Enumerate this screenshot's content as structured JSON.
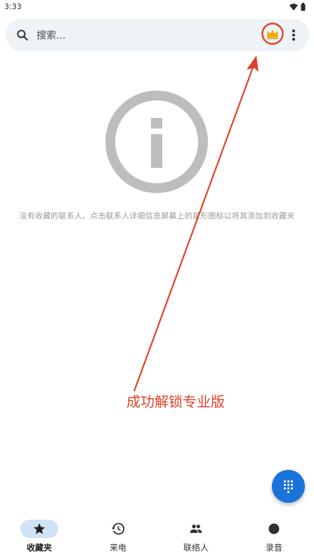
{
  "status_bar": {
    "time": "3:33"
  },
  "search": {
    "placeholder": "搜索..."
  },
  "empty_state": {
    "message": "没有收藏的联系人。点击联系人详细信息屏幕上的星形图标以将其添加到收藏夹"
  },
  "annotation": {
    "text": "成功解锁专业版",
    "color": "#e0412a"
  },
  "bottom_nav": {
    "items": [
      {
        "label": "收藏夹",
        "icon": "star-icon",
        "active": true
      },
      {
        "label": "来电",
        "icon": "history-icon",
        "active": false
      },
      {
        "label": "联络人",
        "icon": "people-icon",
        "active": false
      },
      {
        "label": "录音",
        "icon": "record-icon",
        "active": false
      }
    ]
  },
  "colors": {
    "accent": "#1a73d9",
    "active_tab_bg": "#cfe2f6",
    "search_bg": "#eef3f8",
    "crown": "#f2a900"
  }
}
